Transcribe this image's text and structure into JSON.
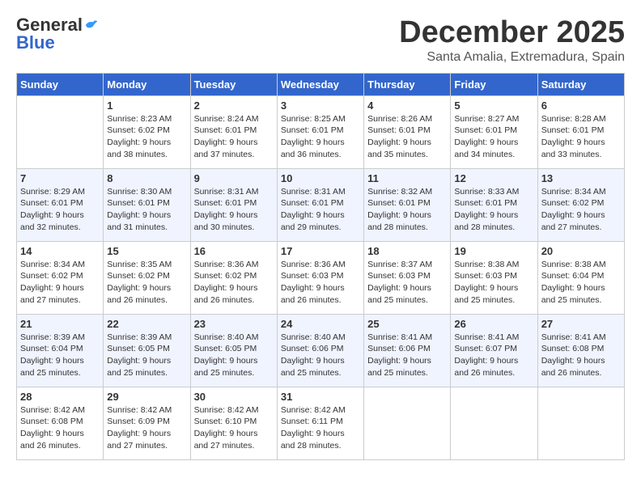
{
  "logo": {
    "general": "General",
    "blue": "Blue"
  },
  "title": "December 2025",
  "location": "Santa Amalia, Extremadura, Spain",
  "weekdays": [
    "Sunday",
    "Monday",
    "Tuesday",
    "Wednesday",
    "Thursday",
    "Friday",
    "Saturday"
  ],
  "weeks": [
    [
      {
        "day": "",
        "sunrise": "",
        "sunset": "",
        "daylight": ""
      },
      {
        "day": "1",
        "sunrise": "Sunrise: 8:23 AM",
        "sunset": "Sunset: 6:02 PM",
        "daylight": "Daylight: 9 hours and 38 minutes."
      },
      {
        "day": "2",
        "sunrise": "Sunrise: 8:24 AM",
        "sunset": "Sunset: 6:01 PM",
        "daylight": "Daylight: 9 hours and 37 minutes."
      },
      {
        "day": "3",
        "sunrise": "Sunrise: 8:25 AM",
        "sunset": "Sunset: 6:01 PM",
        "daylight": "Daylight: 9 hours and 36 minutes."
      },
      {
        "day": "4",
        "sunrise": "Sunrise: 8:26 AM",
        "sunset": "Sunset: 6:01 PM",
        "daylight": "Daylight: 9 hours and 35 minutes."
      },
      {
        "day": "5",
        "sunrise": "Sunrise: 8:27 AM",
        "sunset": "Sunset: 6:01 PM",
        "daylight": "Daylight: 9 hours and 34 minutes."
      },
      {
        "day": "6",
        "sunrise": "Sunrise: 8:28 AM",
        "sunset": "Sunset: 6:01 PM",
        "daylight": "Daylight: 9 hours and 33 minutes."
      }
    ],
    [
      {
        "day": "7",
        "sunrise": "Sunrise: 8:29 AM",
        "sunset": "Sunset: 6:01 PM",
        "daylight": "Daylight: 9 hours and 32 minutes."
      },
      {
        "day": "8",
        "sunrise": "Sunrise: 8:30 AM",
        "sunset": "Sunset: 6:01 PM",
        "daylight": "Daylight: 9 hours and 31 minutes."
      },
      {
        "day": "9",
        "sunrise": "Sunrise: 8:31 AM",
        "sunset": "Sunset: 6:01 PM",
        "daylight": "Daylight: 9 hours and 30 minutes."
      },
      {
        "day": "10",
        "sunrise": "Sunrise: 8:31 AM",
        "sunset": "Sunset: 6:01 PM",
        "daylight": "Daylight: 9 hours and 29 minutes."
      },
      {
        "day": "11",
        "sunrise": "Sunrise: 8:32 AM",
        "sunset": "Sunset: 6:01 PM",
        "daylight": "Daylight: 9 hours and 28 minutes."
      },
      {
        "day": "12",
        "sunrise": "Sunrise: 8:33 AM",
        "sunset": "Sunset: 6:01 PM",
        "daylight": "Daylight: 9 hours and 28 minutes."
      },
      {
        "day": "13",
        "sunrise": "Sunrise: 8:34 AM",
        "sunset": "Sunset: 6:02 PM",
        "daylight": "Daylight: 9 hours and 27 minutes."
      }
    ],
    [
      {
        "day": "14",
        "sunrise": "Sunrise: 8:34 AM",
        "sunset": "Sunset: 6:02 PM",
        "daylight": "Daylight: 9 hours and 27 minutes."
      },
      {
        "day": "15",
        "sunrise": "Sunrise: 8:35 AM",
        "sunset": "Sunset: 6:02 PM",
        "daylight": "Daylight: 9 hours and 26 minutes."
      },
      {
        "day": "16",
        "sunrise": "Sunrise: 8:36 AM",
        "sunset": "Sunset: 6:02 PM",
        "daylight": "Daylight: 9 hours and 26 minutes."
      },
      {
        "day": "17",
        "sunrise": "Sunrise: 8:36 AM",
        "sunset": "Sunset: 6:03 PM",
        "daylight": "Daylight: 9 hours and 26 minutes."
      },
      {
        "day": "18",
        "sunrise": "Sunrise: 8:37 AM",
        "sunset": "Sunset: 6:03 PM",
        "daylight": "Daylight: 9 hours and 25 minutes."
      },
      {
        "day": "19",
        "sunrise": "Sunrise: 8:38 AM",
        "sunset": "Sunset: 6:03 PM",
        "daylight": "Daylight: 9 hours and 25 minutes."
      },
      {
        "day": "20",
        "sunrise": "Sunrise: 8:38 AM",
        "sunset": "Sunset: 6:04 PM",
        "daylight": "Daylight: 9 hours and 25 minutes."
      }
    ],
    [
      {
        "day": "21",
        "sunrise": "Sunrise: 8:39 AM",
        "sunset": "Sunset: 6:04 PM",
        "daylight": "Daylight: 9 hours and 25 minutes."
      },
      {
        "day": "22",
        "sunrise": "Sunrise: 8:39 AM",
        "sunset": "Sunset: 6:05 PM",
        "daylight": "Daylight: 9 hours and 25 minutes."
      },
      {
        "day": "23",
        "sunrise": "Sunrise: 8:40 AM",
        "sunset": "Sunset: 6:05 PM",
        "daylight": "Daylight: 9 hours and 25 minutes."
      },
      {
        "day": "24",
        "sunrise": "Sunrise: 8:40 AM",
        "sunset": "Sunset: 6:06 PM",
        "daylight": "Daylight: 9 hours and 25 minutes."
      },
      {
        "day": "25",
        "sunrise": "Sunrise: 8:41 AM",
        "sunset": "Sunset: 6:06 PM",
        "daylight": "Daylight: 9 hours and 25 minutes."
      },
      {
        "day": "26",
        "sunrise": "Sunrise: 8:41 AM",
        "sunset": "Sunset: 6:07 PM",
        "daylight": "Daylight: 9 hours and 26 minutes."
      },
      {
        "day": "27",
        "sunrise": "Sunrise: 8:41 AM",
        "sunset": "Sunset: 6:08 PM",
        "daylight": "Daylight: 9 hours and 26 minutes."
      }
    ],
    [
      {
        "day": "28",
        "sunrise": "Sunrise: 8:42 AM",
        "sunset": "Sunset: 6:08 PM",
        "daylight": "Daylight: 9 hours and 26 minutes."
      },
      {
        "day": "29",
        "sunrise": "Sunrise: 8:42 AM",
        "sunset": "Sunset: 6:09 PM",
        "daylight": "Daylight: 9 hours and 27 minutes."
      },
      {
        "day": "30",
        "sunrise": "Sunrise: 8:42 AM",
        "sunset": "Sunset: 6:10 PM",
        "daylight": "Daylight: 9 hours and 27 minutes."
      },
      {
        "day": "31",
        "sunrise": "Sunrise: 8:42 AM",
        "sunset": "Sunset: 6:11 PM",
        "daylight": "Daylight: 9 hours and 28 minutes."
      },
      {
        "day": "",
        "sunrise": "",
        "sunset": "",
        "daylight": ""
      },
      {
        "day": "",
        "sunrise": "",
        "sunset": "",
        "daylight": ""
      },
      {
        "day": "",
        "sunrise": "",
        "sunset": "",
        "daylight": ""
      }
    ]
  ]
}
